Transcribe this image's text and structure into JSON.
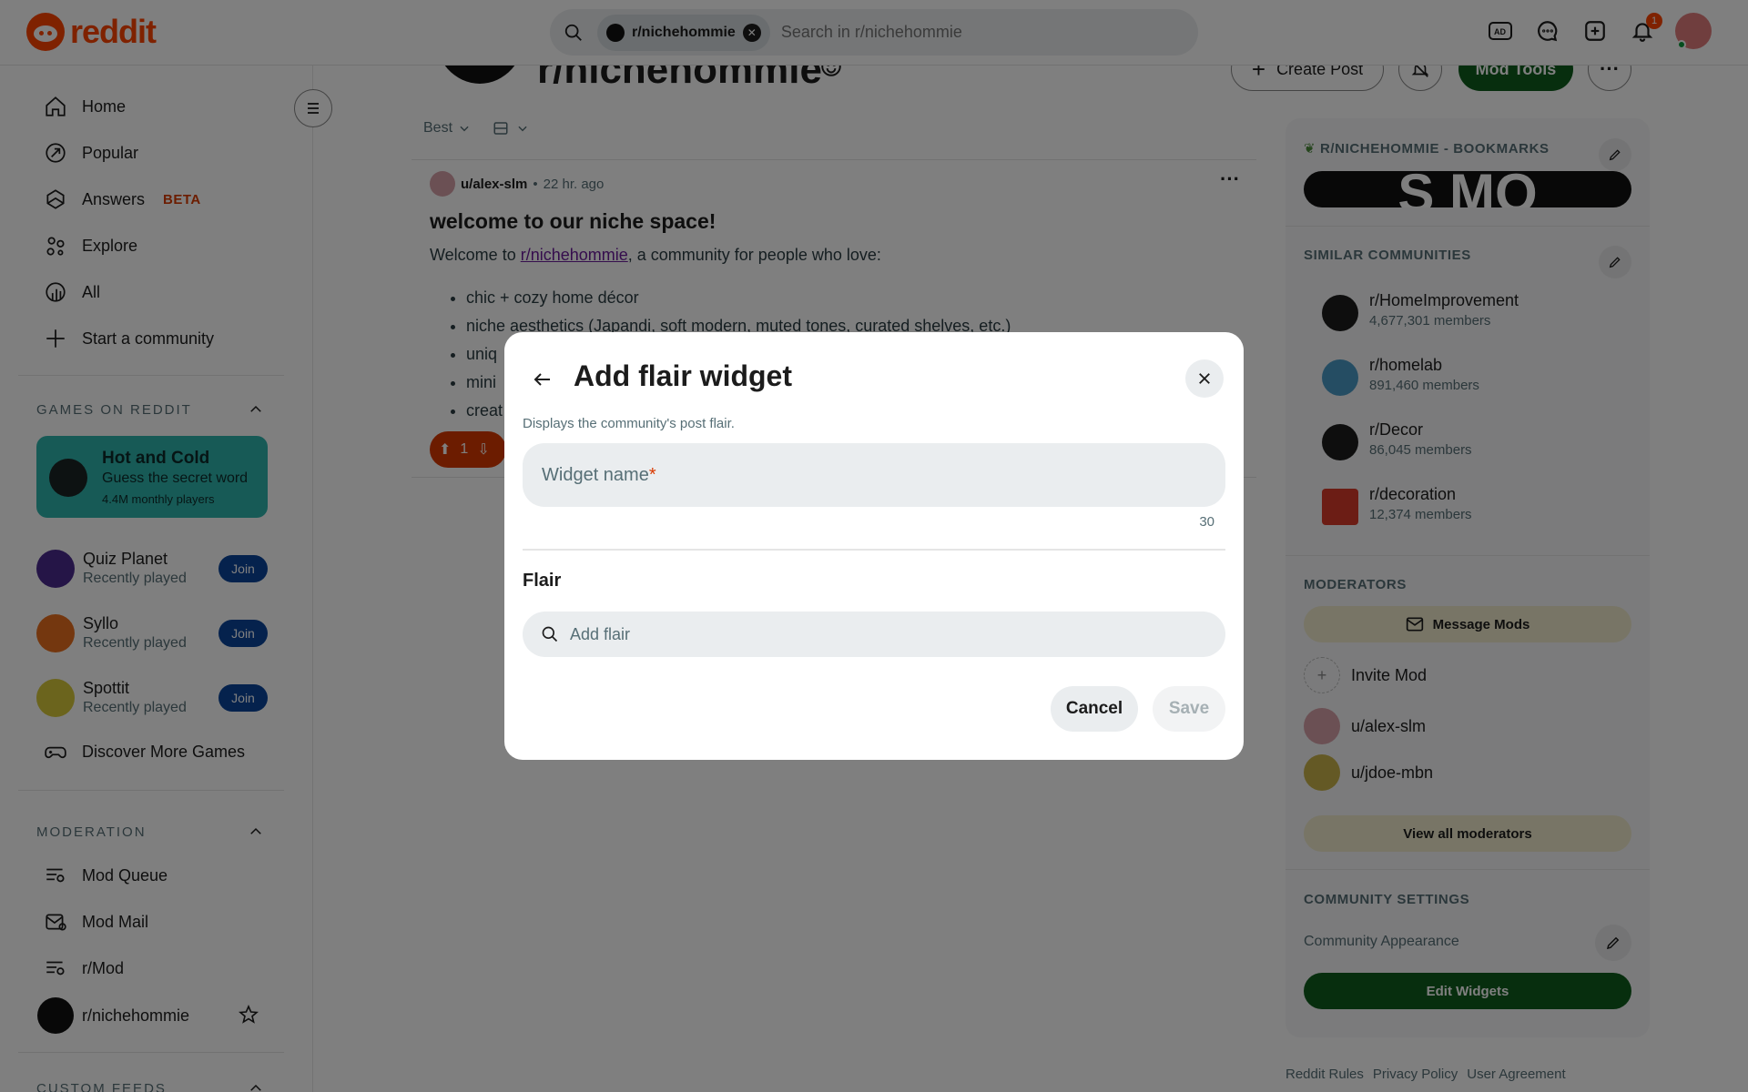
{
  "header": {
    "logo_text": "reddit",
    "search_chip": "r/nichehommie",
    "search_placeholder": "Search in r/nichehommie",
    "notification_count": "1",
    "brand_color": "#ff4500"
  },
  "sidebar": {
    "nav": [
      {
        "label": "Home",
        "icon": "home-icon"
      },
      {
        "label": "Popular",
        "icon": "popular-icon"
      },
      {
        "label": "Answers",
        "icon": "answers-icon",
        "badge": "BETA"
      },
      {
        "label": "Explore",
        "icon": "explore-icon"
      },
      {
        "label": "All",
        "icon": "all-icon"
      },
      {
        "label": "Start a community",
        "icon": "plus-icon"
      }
    ],
    "games_title": "GAMES ON REDDIT",
    "featured_game": {
      "title": "Hot and Cold",
      "subtitle": "Guess the secret word",
      "players": "4.4M monthly players"
    },
    "games": [
      {
        "name": "Quiz Planet",
        "status": "Recently played",
        "join": "Join"
      },
      {
        "name": "Syllo",
        "status": "Recently played",
        "join": "Join"
      },
      {
        "name": "Spottit",
        "status": "Recently played",
        "join": "Join"
      }
    ],
    "discover_games": "Discover More Games",
    "moderation_title": "MODERATION",
    "moderation": [
      {
        "label": "Mod Queue"
      },
      {
        "label": "Mod Mail"
      },
      {
        "label": "r/Mod"
      },
      {
        "label": "r/nichehommie"
      }
    ],
    "custom_feeds_title": "CUSTOM FEEDS"
  },
  "main": {
    "subreddit_name": "r/nichehommie",
    "create_post": "Create Post",
    "mod_tools": "Mod Tools",
    "sort": "Best",
    "post": {
      "author": "u/alex-slm",
      "time": "22 hr. ago",
      "title": "welcome to our niche space!",
      "body_prefix": "Welcome to ",
      "body_link": "r/nichehommie",
      "body_suffix": ", a community for people who love:",
      "list": [
        "chic + cozy home décor",
        "niche aesthetics (Japandi, soft modern, muted tones, curated shelves, etc.)",
        "uniq",
        "mini",
        "creat"
      ],
      "votes": "1"
    }
  },
  "right_sidebar": {
    "bookmarks_title": "R/NICHEHOMMIE - BOOKMARKS",
    "similar_title": "SIMILAR COMMUNITIES",
    "communities": [
      {
        "name": "r/HomeImprovement",
        "members": "4,677,301 members"
      },
      {
        "name": "r/homelab",
        "members": "891,460 members"
      },
      {
        "name": "r/Decor",
        "members": "86,045 members"
      },
      {
        "name": "r/decoration",
        "members": "12,374 members"
      }
    ],
    "moderators_title": "MODERATORS",
    "message_mods": "Message Mods",
    "invite_mod": "Invite Mod",
    "moderators": [
      "u/alex-slm",
      "u/jdoe-mbn"
    ],
    "view_all_mods": "View all moderators",
    "community_settings_title": "COMMUNITY SETTINGS",
    "community_appearance": "Community Appearance",
    "edit_widgets": "Edit Widgets"
  },
  "footer": {
    "links": [
      "Reddit Rules",
      "Privacy Policy",
      "User Agreement"
    ]
  },
  "modal": {
    "title": "Add flair widget",
    "description": "Displays the community's post flair.",
    "widget_name_placeholder": "Widget name",
    "required_mark": "*",
    "char_count": "30",
    "flair_label": "Flair",
    "flair_placeholder": "Add flair",
    "cancel": "Cancel",
    "save": "Save"
  }
}
